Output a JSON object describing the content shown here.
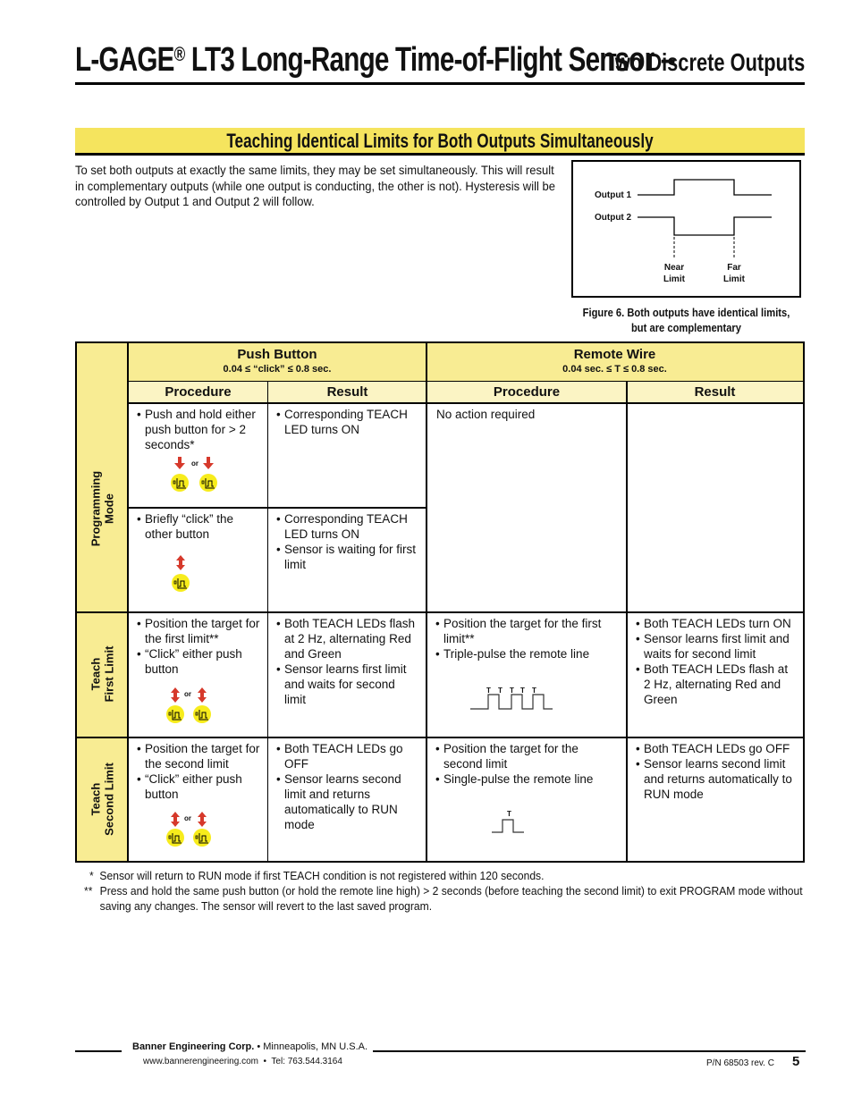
{
  "header": {
    "title_main": "L-GAGE",
    "title_reg": "®",
    "title_rest": " LT3 Long-Range Time-of-Flight Sensor –",
    "title_sub": "Two Discrete Outputs"
  },
  "section": {
    "title": "Teaching Identical Limits for Both Outputs Simultaneously"
  },
  "intro": {
    "text": "To set both outputs at exactly the same limits, they may be set simultaneously. This will result in complementary outputs (while one output is conducting, the other is not). Hysteresis will be controlled by Output 1 and Output 2 will follow."
  },
  "figure": {
    "output1_label": "Output 1",
    "output2_label": "Output 2",
    "near_limit_line1": "Near",
    "near_limit_line2": "Limit",
    "far_limit_line1": "Far",
    "far_limit_line2": "Limit",
    "caption_line1": "Figure 6. Both outputs have identical limits,",
    "caption_line2": "but are complementary"
  },
  "table": {
    "push_button": {
      "title": "Push Button",
      "timing": "0.04 ≤ “click” ≤ 0.8 sec."
    },
    "remote_wire": {
      "title": "Remote Wire",
      "timing": "0.04 sec. ≤ T ≤ 0.8 sec."
    },
    "columns": [
      "Procedure",
      "Result",
      "Procedure",
      "Result"
    ],
    "or_label": "or",
    "pulse_label": "T",
    "rows": [
      {
        "label_line1": "Programming",
        "label_line2": "Mode",
        "push_steps": [
          {
            "procedure": [
              "Push and hold either push button for > 2 seconds*"
            ],
            "result": [
              "Corresponding TEACH LED turns ON"
            ]
          },
          {
            "procedure": [
              "Briefly “click” the other button"
            ],
            "result": [
              "Corresponding TEACH LED turns ON",
              "Sensor is waiting for first limit"
            ]
          }
        ],
        "remote_procedure": "No action required",
        "remote_result": []
      },
      {
        "label_line1": "Teach",
        "label_line2": "First Limit",
        "push_procedure": [
          "Position the target for the first limit**",
          "“Click” either push button"
        ],
        "push_result": [
          "Both TEACH LEDs flash at 2 Hz, alternating Red and Green",
          "Sensor learns first limit and waits for second limit"
        ],
        "remote_procedure": [
          "Position the target for the first limit**",
          "Triple-pulse the remote line"
        ],
        "remote_result": [
          "Both TEACH LEDs turn ON",
          "Sensor learns first limit and waits for second limit",
          "Both TEACH LEDs flash at 2 Hz, alternating Red and Green"
        ]
      },
      {
        "label_line1": "Teach",
        "label_line2": "Second Limit",
        "push_procedure": [
          "Position the target for the second limit",
          "“Click” either push button"
        ],
        "push_result": [
          "Both TEACH LEDs go OFF",
          "Sensor learns second limit and returns automatically to RUN mode"
        ],
        "remote_procedure": [
          "Position the target for the second limit",
          "Single-pulse the remote line"
        ],
        "remote_result": [
          "Both TEACH LEDs go OFF",
          "Sensor learns second limit and returns automatically to RUN mode"
        ]
      }
    ]
  },
  "footnotes": [
    {
      "mark": "*",
      "text": "Sensor will return to RUN mode if first TEACH condition is not registered within 120 seconds."
    },
    {
      "mark": "**",
      "text": "Press and hold the same push button (or hold the remote line high) > 2 seconds (before teaching the second limit) to exit PROGRAM mode without saving any changes. The sensor will revert to the last saved program."
    }
  ],
  "footer": {
    "company": "Banner Engineering Corp.",
    "location": " • Minneapolis, MN U.S.A.",
    "website": "www.bannerengineering.com",
    "separator": "  •  ",
    "phone": "Tel: 763.544.3164",
    "part_number": "P/N 68503 rev. C",
    "page_number": "5"
  },
  "colors": {
    "banner_yellow": "#f5e45e",
    "header_yellow": "#f8ec93",
    "subheader_yellow": "#fbf4c4",
    "button_yellow": "#f7ec1c",
    "arrow_red": "#d6392b"
  }
}
